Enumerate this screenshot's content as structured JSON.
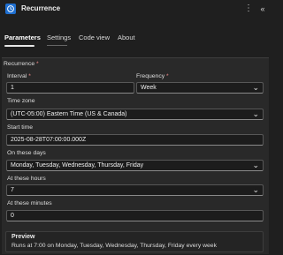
{
  "header": {
    "title": "Recurrence",
    "more_icon": "more-vertical-icon",
    "collapse_icon": "double-chevron-right-icon"
  },
  "tabs": [
    {
      "label": "Parameters",
      "active": true
    },
    {
      "label": "Settings",
      "active": false
    },
    {
      "label": "Code view",
      "active": false
    },
    {
      "label": "About",
      "active": false
    }
  ],
  "recurrence": {
    "section_label": "Recurrence",
    "required_mark": "*",
    "interval": {
      "label": "Interval",
      "value": "1"
    },
    "frequency": {
      "label": "Frequency",
      "value": "Week"
    },
    "time_zone": {
      "label": "Time zone",
      "value": "(UTC-05:00) Eastern Time (US & Canada)"
    },
    "start_time": {
      "label": "Start time",
      "value": "2025-08-28T07:00:00.000Z"
    },
    "on_these_days": {
      "label": "On these days",
      "value": "Monday, Tuesday, Wednesday, Thursday, Friday"
    },
    "at_these_hours": {
      "label": "At these hours",
      "value": "7"
    },
    "at_these_minutes": {
      "label": "At these minutes",
      "value": "0"
    },
    "preview": {
      "title": "Preview",
      "text": "Runs at 7:00 on Monday, Tuesday, Wednesday, Thursday, Friday every week"
    }
  },
  "colors": {
    "accent": "#1f6fd0",
    "background": "#1f1f1f",
    "panel": "#292929",
    "required": "#f08a8a"
  }
}
